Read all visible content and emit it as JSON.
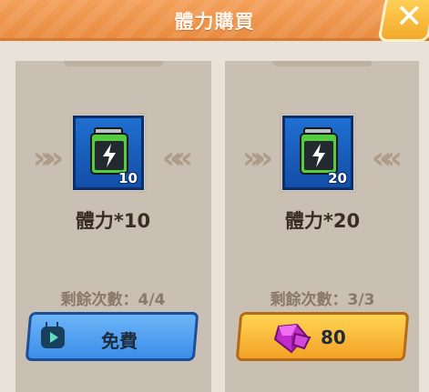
{
  "header": {
    "title": "體力購買",
    "close_icon": "close-icon",
    "accent": "#ee9447"
  },
  "offers": [
    {
      "name": "體力*10",
      "quantity_badge": "10",
      "remaining": "剩餘次數：4/4",
      "button": {
        "label": "免費",
        "icon": "video-ad-icon",
        "color": "#4a9cf0"
      }
    },
    {
      "name": "體力*20",
      "quantity_badge": "20",
      "remaining": "剩餘次數：3/3",
      "button": {
        "label": "80",
        "icon": "gem-icon",
        "color": "#f7b733"
      }
    }
  ]
}
